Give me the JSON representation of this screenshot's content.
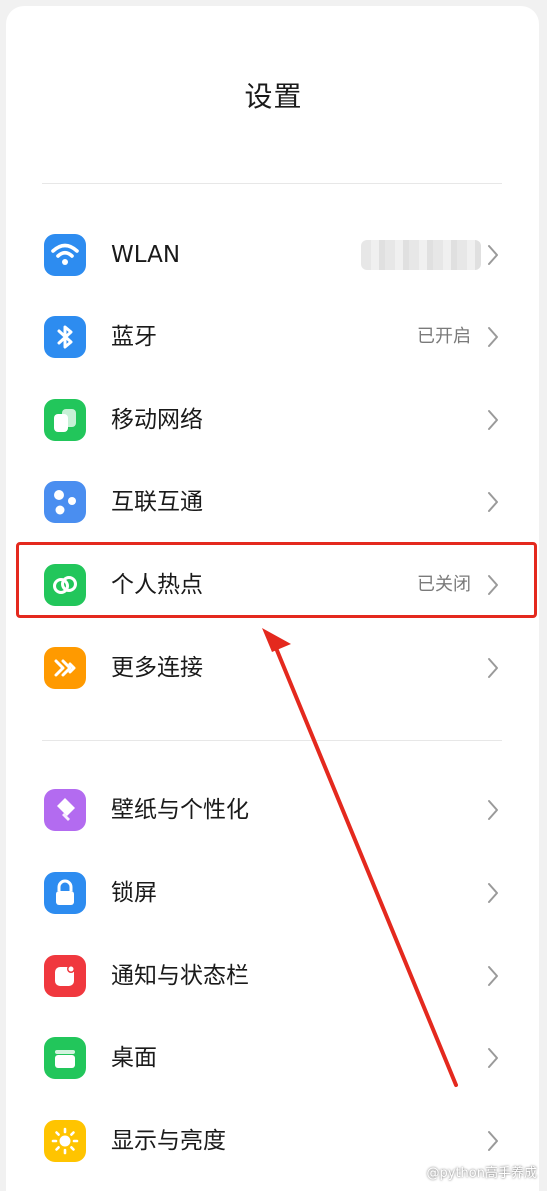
{
  "header": {
    "title": "设置"
  },
  "items": [
    {
      "label": "WLAN",
      "status": "",
      "icon": "wifi-icon",
      "color": "#2d8cf0"
    },
    {
      "label": "蓝牙",
      "status": "已开启",
      "icon": "bluetooth-icon",
      "color": "#2d8cf0"
    },
    {
      "label": "移动网络",
      "status": "",
      "icon": "mobile-network-icon",
      "color": "#22c65b"
    },
    {
      "label": "互联互通",
      "status": "",
      "icon": "interconnect-icon",
      "color": "#4a8ef0"
    },
    {
      "label": "个人热点",
      "status": "已关闭",
      "icon": "hotspot-icon",
      "color": "#22c65b"
    },
    {
      "label": "更多连接",
      "status": "",
      "icon": "more-connections-icon",
      "color": "#ff9a00"
    },
    {
      "label": "壁纸与个性化",
      "status": "",
      "icon": "wallpaper-icon",
      "color": "#b36bf0"
    },
    {
      "label": "锁屏",
      "status": "",
      "icon": "lock-icon",
      "color": "#2d8cf0"
    },
    {
      "label": "通知与状态栏",
      "status": "",
      "icon": "notification-icon",
      "color": "#f0383e"
    },
    {
      "label": "桌面",
      "status": "",
      "icon": "desktop-icon",
      "color": "#22c65b"
    },
    {
      "label": "显示与亮度",
      "status": "",
      "icon": "brightness-icon",
      "color": "#ffc400"
    }
  ],
  "annotation": {
    "highlight_color": "#e4291e"
  },
  "watermark": "@python高手养成"
}
